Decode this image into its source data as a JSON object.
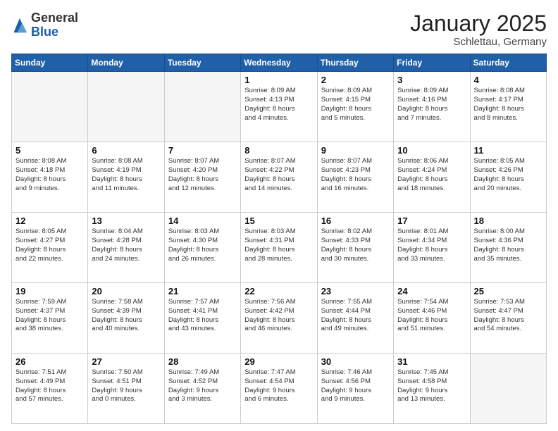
{
  "logo": {
    "general": "General",
    "blue": "Blue"
  },
  "header": {
    "month": "January 2025",
    "location": "Schlettau, Germany"
  },
  "days_of_week": [
    "Sunday",
    "Monday",
    "Tuesday",
    "Wednesday",
    "Thursday",
    "Friday",
    "Saturday"
  ],
  "weeks": [
    [
      {
        "day": "",
        "text": ""
      },
      {
        "day": "",
        "text": ""
      },
      {
        "day": "",
        "text": ""
      },
      {
        "day": "1",
        "text": "Sunrise: 8:09 AM\nSunset: 4:13 PM\nDaylight: 8 hours\nand 4 minutes."
      },
      {
        "day": "2",
        "text": "Sunrise: 8:09 AM\nSunset: 4:15 PM\nDaylight: 8 hours\nand 5 minutes."
      },
      {
        "day": "3",
        "text": "Sunrise: 8:09 AM\nSunset: 4:16 PM\nDaylight: 8 hours\nand 7 minutes."
      },
      {
        "day": "4",
        "text": "Sunrise: 8:08 AM\nSunset: 4:17 PM\nDaylight: 8 hours\nand 8 minutes."
      }
    ],
    [
      {
        "day": "5",
        "text": "Sunrise: 8:08 AM\nSunset: 4:18 PM\nDaylight: 8 hours\nand 9 minutes."
      },
      {
        "day": "6",
        "text": "Sunrise: 8:08 AM\nSunset: 4:19 PM\nDaylight: 8 hours\nand 11 minutes."
      },
      {
        "day": "7",
        "text": "Sunrise: 8:07 AM\nSunset: 4:20 PM\nDaylight: 8 hours\nand 12 minutes."
      },
      {
        "day": "8",
        "text": "Sunrise: 8:07 AM\nSunset: 4:22 PM\nDaylight: 8 hours\nand 14 minutes."
      },
      {
        "day": "9",
        "text": "Sunrise: 8:07 AM\nSunset: 4:23 PM\nDaylight: 8 hours\nand 16 minutes."
      },
      {
        "day": "10",
        "text": "Sunrise: 8:06 AM\nSunset: 4:24 PM\nDaylight: 8 hours\nand 18 minutes."
      },
      {
        "day": "11",
        "text": "Sunrise: 8:05 AM\nSunset: 4:26 PM\nDaylight: 8 hours\nand 20 minutes."
      }
    ],
    [
      {
        "day": "12",
        "text": "Sunrise: 8:05 AM\nSunset: 4:27 PM\nDaylight: 8 hours\nand 22 minutes."
      },
      {
        "day": "13",
        "text": "Sunrise: 8:04 AM\nSunset: 4:28 PM\nDaylight: 8 hours\nand 24 minutes."
      },
      {
        "day": "14",
        "text": "Sunrise: 8:03 AM\nSunset: 4:30 PM\nDaylight: 8 hours\nand 26 minutes."
      },
      {
        "day": "15",
        "text": "Sunrise: 8:03 AM\nSunset: 4:31 PM\nDaylight: 8 hours\nand 28 minutes."
      },
      {
        "day": "16",
        "text": "Sunrise: 8:02 AM\nSunset: 4:33 PM\nDaylight: 8 hours\nand 30 minutes."
      },
      {
        "day": "17",
        "text": "Sunrise: 8:01 AM\nSunset: 4:34 PM\nDaylight: 8 hours\nand 33 minutes."
      },
      {
        "day": "18",
        "text": "Sunrise: 8:00 AM\nSunset: 4:36 PM\nDaylight: 8 hours\nand 35 minutes."
      }
    ],
    [
      {
        "day": "19",
        "text": "Sunrise: 7:59 AM\nSunset: 4:37 PM\nDaylight: 8 hours\nand 38 minutes."
      },
      {
        "day": "20",
        "text": "Sunrise: 7:58 AM\nSunset: 4:39 PM\nDaylight: 8 hours\nand 40 minutes."
      },
      {
        "day": "21",
        "text": "Sunrise: 7:57 AM\nSunset: 4:41 PM\nDaylight: 8 hours\nand 43 minutes."
      },
      {
        "day": "22",
        "text": "Sunrise: 7:56 AM\nSunset: 4:42 PM\nDaylight: 8 hours\nand 46 minutes."
      },
      {
        "day": "23",
        "text": "Sunrise: 7:55 AM\nSunset: 4:44 PM\nDaylight: 8 hours\nand 49 minutes."
      },
      {
        "day": "24",
        "text": "Sunrise: 7:54 AM\nSunset: 4:46 PM\nDaylight: 8 hours\nand 51 minutes."
      },
      {
        "day": "25",
        "text": "Sunrise: 7:53 AM\nSunset: 4:47 PM\nDaylight: 8 hours\nand 54 minutes."
      }
    ],
    [
      {
        "day": "26",
        "text": "Sunrise: 7:51 AM\nSunset: 4:49 PM\nDaylight: 8 hours\nand 57 minutes."
      },
      {
        "day": "27",
        "text": "Sunrise: 7:50 AM\nSunset: 4:51 PM\nDaylight: 9 hours\nand 0 minutes."
      },
      {
        "day": "28",
        "text": "Sunrise: 7:49 AM\nSunset: 4:52 PM\nDaylight: 9 hours\nand 3 minutes."
      },
      {
        "day": "29",
        "text": "Sunrise: 7:47 AM\nSunset: 4:54 PM\nDaylight: 9 hours\nand 6 minutes."
      },
      {
        "day": "30",
        "text": "Sunrise: 7:46 AM\nSunset: 4:56 PM\nDaylight: 9 hours\nand 9 minutes."
      },
      {
        "day": "31",
        "text": "Sunrise: 7:45 AM\nSunset: 4:58 PM\nDaylight: 9 hours\nand 13 minutes."
      },
      {
        "day": "",
        "text": ""
      }
    ]
  ]
}
